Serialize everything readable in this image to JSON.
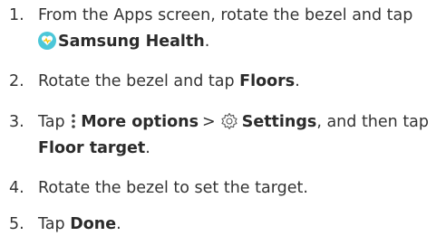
{
  "steps": [
    {
      "number": "1.",
      "text1": "From the Apps screen, rotate the bezel and tap",
      "bold1": "Samsung Health",
      "text2": ".",
      "icon": "samsung-health-app-icon"
    },
    {
      "number": "2.",
      "text1": "Rotate the bezel and tap ",
      "bold1": "Floors",
      "text2": "."
    },
    {
      "number": "3.",
      "text1": "Tap ",
      "bold1": "More options",
      "sep": ">",
      "bold2": "Settings",
      "text2": ", and then tap",
      "bold3": "Floor target",
      "text3": ".",
      "icons": [
        "more-options-icon",
        "settings-gear-icon"
      ]
    },
    {
      "number": "4.",
      "text1": "Rotate the bezel to set the target."
    },
    {
      "number": "5.",
      "text1": "Tap ",
      "bold1": "Done",
      "text2": "."
    }
  ],
  "colors": {
    "text": "#333333",
    "health_icon_bg": "#4cc7d8",
    "health_icon_fg": "#f5c400"
  }
}
